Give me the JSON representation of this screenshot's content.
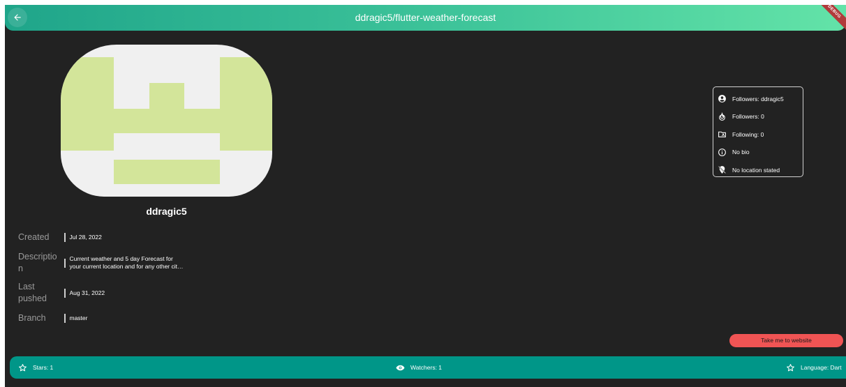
{
  "appbar": {
    "title": "ddragic5/flutter-weather-forecast",
    "back_icon": "arrow-left-icon",
    "debug_label": "DEBUG"
  },
  "profile": {
    "username": "ddragic5",
    "avatar_colors": {
      "background": "#f0f0f0",
      "pattern": "#d3e59a"
    }
  },
  "info": {
    "created": {
      "label": "Created",
      "value": "Jul 28, 2022"
    },
    "description": {
      "label_line1": "Descriptio",
      "label_line2": "n",
      "value_line1": "Current weather and 5 day Forecast for",
      "value_line2": "your current location and for any other cit…"
    },
    "last_pushed": {
      "label_line1": "Last",
      "label_line2": "pushed",
      "value": "Aug 31, 2022"
    },
    "branch": {
      "label": "Branch",
      "value": "master"
    }
  },
  "side_card": {
    "items": [
      {
        "icon": "account-circle-icon",
        "text": "Followers: ddragic5"
      },
      {
        "icon": "flame-icon",
        "text": "Followers: 0"
      },
      {
        "icon": "folder-shared-icon",
        "text": "Following: 0"
      },
      {
        "icon": "info-icon",
        "text": "No bio"
      },
      {
        "icon": "location-off-icon",
        "text": "No location stated"
      }
    ]
  },
  "website_button": {
    "label": "Take me to website",
    "color": "#f05454"
  },
  "stats": {
    "stars": {
      "icon": "star-outline-icon",
      "text": "Stars: 1"
    },
    "watchers": {
      "icon": "eye-icon",
      "text": "Watchers: 1"
    },
    "language": {
      "icon": "star-outline-icon",
      "text": "Language: Dart"
    }
  },
  "colors": {
    "background": "#222222",
    "appbar_start": "#1fa58a",
    "appbar_end": "#63e3a8",
    "bottombar": "#009688"
  }
}
